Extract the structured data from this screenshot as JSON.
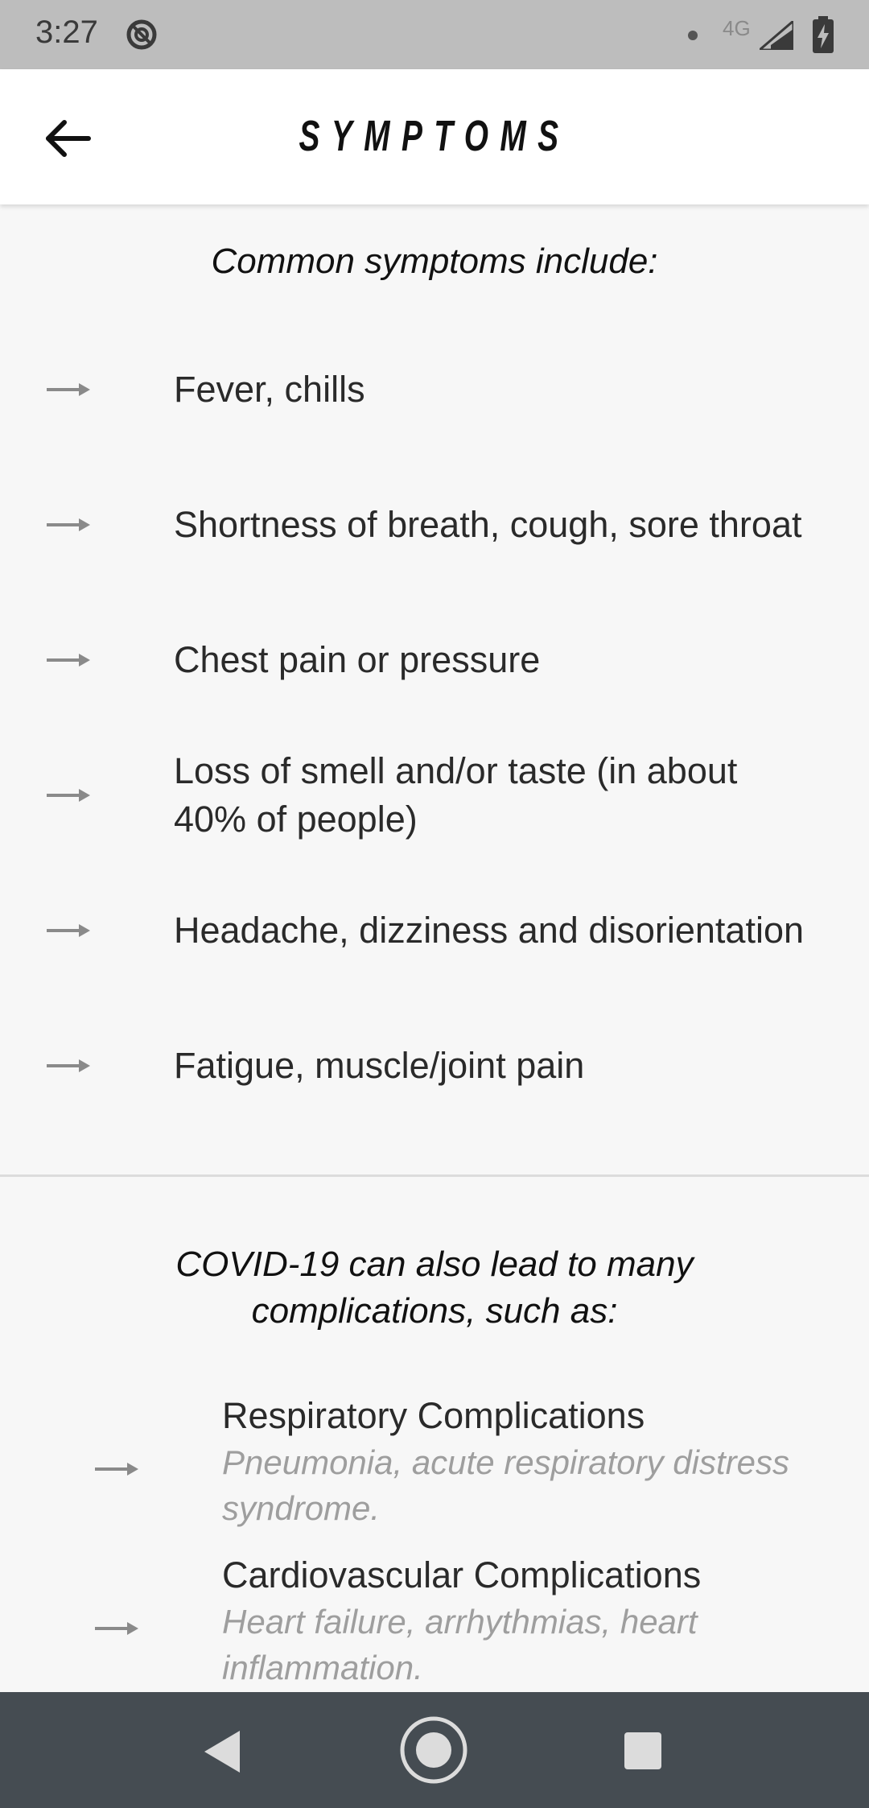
{
  "status_bar": {
    "time": "3:27",
    "network": "4G",
    "icons": [
      "do-not-disturb-icon",
      "notification-dot-icon",
      "cell-signal-icon",
      "battery-charging-icon"
    ]
  },
  "app_bar": {
    "title": "SYMPTOMS",
    "back_icon": "arrow-left-icon"
  },
  "symptoms": {
    "heading": "Common symptoms include:",
    "items": [
      "Fever, chills",
      "Shortness of breath, cough, sore throat",
      "Chest pain or pressure",
      "Loss of smell and/or taste (in about 40% of people)",
      "Headache, dizziness and disorientation",
      "Fatigue, muscle/joint pain"
    ]
  },
  "complications": {
    "heading": "COVID-19 can also lead to many complications, such as:",
    "items": [
      {
        "title": "Respiratory Complications",
        "description": "Pneumonia, acute respiratory distress syndrome."
      },
      {
        "title": "Cardiovascular Complications",
        "description": "Heart failure, arrhythmias, heart inflammation."
      }
    ]
  },
  "nav_bar": {
    "icons": [
      "nav-back-icon",
      "nav-home-icon",
      "nav-recents-icon"
    ]
  },
  "colors": {
    "status_bar_bg": "#bdbdbd",
    "app_bar_bg": "#ffffff",
    "page_bg": "#f7f7f7",
    "arrow": "#8a8a8a",
    "description_text": "#9e9e9e",
    "nav_bar_bg": "#454c52"
  }
}
